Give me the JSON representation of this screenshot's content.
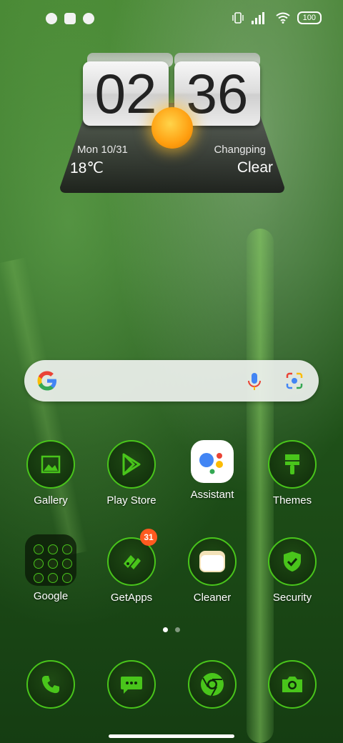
{
  "status_bar": {
    "battery": "100"
  },
  "clock_widget": {
    "hour": "02",
    "minute": "36",
    "date": "Mon  10/31",
    "location": "Changping",
    "temperature": "18℃",
    "condition": "Clear"
  },
  "search_bar": {
    "placeholder": ""
  },
  "apps": [
    {
      "label": "Gallery",
      "icon": "gallery-icon"
    },
    {
      "label": "Play Store",
      "icon": "play-store-icon"
    },
    {
      "label": "Assistant",
      "icon": "assistant-icon"
    },
    {
      "label": "Themes",
      "icon": "themes-icon"
    },
    {
      "label": "Google",
      "icon": "google-folder-icon"
    },
    {
      "label": "GetApps",
      "icon": "getapps-icon",
      "badge": "31"
    },
    {
      "label": "Cleaner",
      "icon": "cleaner-icon"
    },
    {
      "label": "Security",
      "icon": "security-icon"
    }
  ],
  "dock": [
    {
      "icon": "phone-icon"
    },
    {
      "icon": "messages-icon"
    },
    {
      "icon": "chrome-icon"
    },
    {
      "icon": "camera-icon"
    }
  ],
  "colors": {
    "accent_green": "#49c51b",
    "badge_orange": "#ff5a1f"
  }
}
